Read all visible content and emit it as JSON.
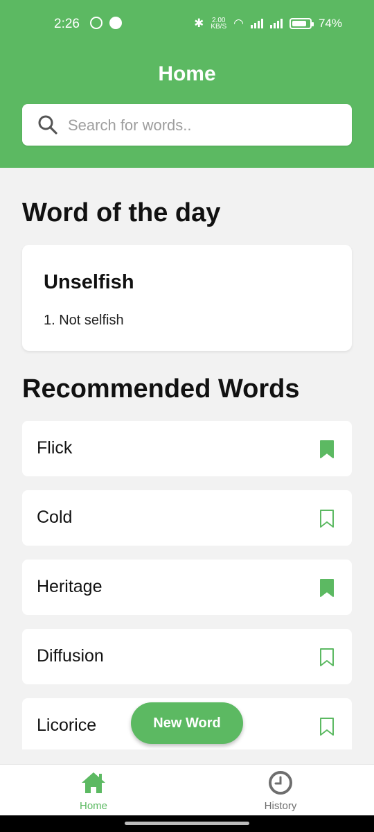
{
  "status_bar": {
    "time": "2:26",
    "speed": "2.00",
    "speed_unit": "KB/S",
    "battery": "74%"
  },
  "header": {
    "title": "Home"
  },
  "search": {
    "placeholder": "Search for words.."
  },
  "word_of_day": {
    "heading": "Word of the day",
    "word": "Unselfish",
    "definition": "1. Not selfish"
  },
  "recommended": {
    "heading": "Recommended Words",
    "items": [
      {
        "label": "Flick",
        "bookmarked": true
      },
      {
        "label": "Cold",
        "bookmarked": false
      },
      {
        "label": "Heritage",
        "bookmarked": true
      },
      {
        "label": "Diffusion",
        "bookmarked": false
      },
      {
        "label": "Licorice",
        "bookmarked": false
      }
    ]
  },
  "fab": {
    "label": "New Word"
  },
  "nav": {
    "home": {
      "label": "Home",
      "icon": "home-icon",
      "active": true
    },
    "history": {
      "label": "History",
      "icon": "clock-icon",
      "active": false
    }
  },
  "colors": {
    "primary": "#5cb962",
    "background": "#f2f2f2",
    "inactive": "#6e6e6e"
  }
}
